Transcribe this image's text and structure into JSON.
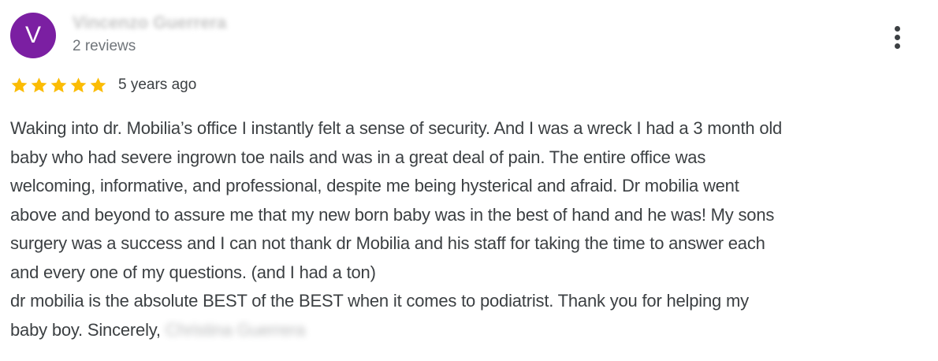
{
  "reviewer": {
    "avatar_letter": "V",
    "avatar_color": "#7b1fa2",
    "name": "Vincenzo Guerrera",
    "review_count": "2 reviews"
  },
  "rating": {
    "stars": 5,
    "max_stars": 5,
    "star_color": "#fbbc04",
    "date": "5 years ago"
  },
  "icons": {
    "more": "more-vert-icon",
    "star": "star-icon"
  },
  "review": {
    "lines": [
      "Waking into dr. Mobilia’s office I instantly felt a sense of security. And I was a wreck I had a 3 month old",
      "baby who had severe ingrown toe nails and was in a great deal of pain. The entire office was",
      "welcoming, informative, and professional, despite me being hysterical and afraid. Dr mobilia went",
      "above and beyond to assure me that my new born baby was in the best of hand and he was! My sons",
      "surgery was a success and I can not thank dr Mobilia and his staff for taking the time to answer each",
      "and every one of my questions. (and I had a ton)",
      "dr mobilia is the absolute BEST of the BEST when it comes to podiatrist. Thank you for helping my"
    ],
    "last_line_prefix": "baby boy. Sincerely,",
    "last_line_blurred": "Christina Guerrera"
  }
}
